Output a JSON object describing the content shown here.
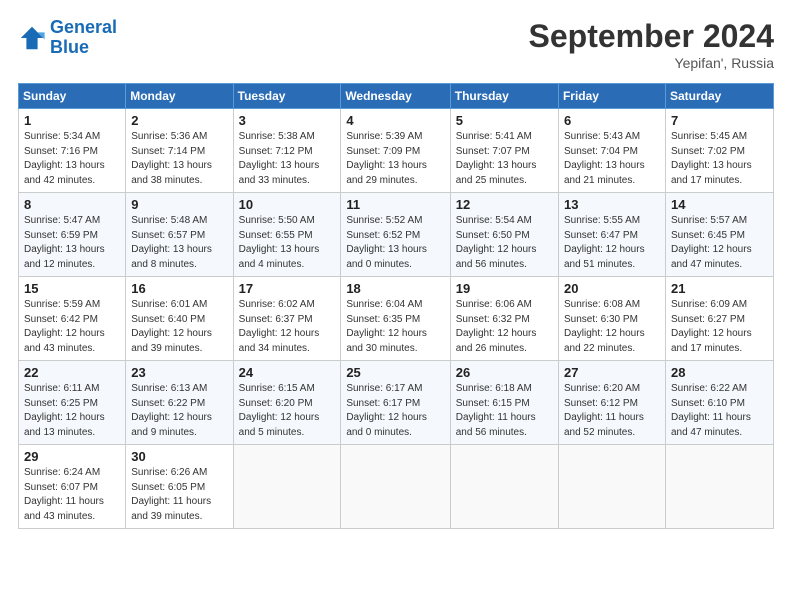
{
  "header": {
    "logo_line1": "General",
    "logo_line2": "Blue",
    "month_title": "September 2024",
    "location": "Yepifan', Russia"
  },
  "weekdays": [
    "Sunday",
    "Monday",
    "Tuesday",
    "Wednesday",
    "Thursday",
    "Friday",
    "Saturday"
  ],
  "weeks": [
    [
      {
        "day": "1",
        "info": "Sunrise: 5:34 AM\nSunset: 7:16 PM\nDaylight: 13 hours\nand 42 minutes."
      },
      {
        "day": "2",
        "info": "Sunrise: 5:36 AM\nSunset: 7:14 PM\nDaylight: 13 hours\nand 38 minutes."
      },
      {
        "day": "3",
        "info": "Sunrise: 5:38 AM\nSunset: 7:12 PM\nDaylight: 13 hours\nand 33 minutes."
      },
      {
        "day": "4",
        "info": "Sunrise: 5:39 AM\nSunset: 7:09 PM\nDaylight: 13 hours\nand 29 minutes."
      },
      {
        "day": "5",
        "info": "Sunrise: 5:41 AM\nSunset: 7:07 PM\nDaylight: 13 hours\nand 25 minutes."
      },
      {
        "day": "6",
        "info": "Sunrise: 5:43 AM\nSunset: 7:04 PM\nDaylight: 13 hours\nand 21 minutes."
      },
      {
        "day": "7",
        "info": "Sunrise: 5:45 AM\nSunset: 7:02 PM\nDaylight: 13 hours\nand 17 minutes."
      }
    ],
    [
      {
        "day": "8",
        "info": "Sunrise: 5:47 AM\nSunset: 6:59 PM\nDaylight: 13 hours\nand 12 minutes."
      },
      {
        "day": "9",
        "info": "Sunrise: 5:48 AM\nSunset: 6:57 PM\nDaylight: 13 hours\nand 8 minutes."
      },
      {
        "day": "10",
        "info": "Sunrise: 5:50 AM\nSunset: 6:55 PM\nDaylight: 13 hours\nand 4 minutes."
      },
      {
        "day": "11",
        "info": "Sunrise: 5:52 AM\nSunset: 6:52 PM\nDaylight: 13 hours\nand 0 minutes."
      },
      {
        "day": "12",
        "info": "Sunrise: 5:54 AM\nSunset: 6:50 PM\nDaylight: 12 hours\nand 56 minutes."
      },
      {
        "day": "13",
        "info": "Sunrise: 5:55 AM\nSunset: 6:47 PM\nDaylight: 12 hours\nand 51 minutes."
      },
      {
        "day": "14",
        "info": "Sunrise: 5:57 AM\nSunset: 6:45 PM\nDaylight: 12 hours\nand 47 minutes."
      }
    ],
    [
      {
        "day": "15",
        "info": "Sunrise: 5:59 AM\nSunset: 6:42 PM\nDaylight: 12 hours\nand 43 minutes."
      },
      {
        "day": "16",
        "info": "Sunrise: 6:01 AM\nSunset: 6:40 PM\nDaylight: 12 hours\nand 39 minutes."
      },
      {
        "day": "17",
        "info": "Sunrise: 6:02 AM\nSunset: 6:37 PM\nDaylight: 12 hours\nand 34 minutes."
      },
      {
        "day": "18",
        "info": "Sunrise: 6:04 AM\nSunset: 6:35 PM\nDaylight: 12 hours\nand 30 minutes."
      },
      {
        "day": "19",
        "info": "Sunrise: 6:06 AM\nSunset: 6:32 PM\nDaylight: 12 hours\nand 26 minutes."
      },
      {
        "day": "20",
        "info": "Sunrise: 6:08 AM\nSunset: 6:30 PM\nDaylight: 12 hours\nand 22 minutes."
      },
      {
        "day": "21",
        "info": "Sunrise: 6:09 AM\nSunset: 6:27 PM\nDaylight: 12 hours\nand 17 minutes."
      }
    ],
    [
      {
        "day": "22",
        "info": "Sunrise: 6:11 AM\nSunset: 6:25 PM\nDaylight: 12 hours\nand 13 minutes."
      },
      {
        "day": "23",
        "info": "Sunrise: 6:13 AM\nSunset: 6:22 PM\nDaylight: 12 hours\nand 9 minutes."
      },
      {
        "day": "24",
        "info": "Sunrise: 6:15 AM\nSunset: 6:20 PM\nDaylight: 12 hours\nand 5 minutes."
      },
      {
        "day": "25",
        "info": "Sunrise: 6:17 AM\nSunset: 6:17 PM\nDaylight: 12 hours\nand 0 minutes."
      },
      {
        "day": "26",
        "info": "Sunrise: 6:18 AM\nSunset: 6:15 PM\nDaylight: 11 hours\nand 56 minutes."
      },
      {
        "day": "27",
        "info": "Sunrise: 6:20 AM\nSunset: 6:12 PM\nDaylight: 11 hours\nand 52 minutes."
      },
      {
        "day": "28",
        "info": "Sunrise: 6:22 AM\nSunset: 6:10 PM\nDaylight: 11 hours\nand 47 minutes."
      }
    ],
    [
      {
        "day": "29",
        "info": "Sunrise: 6:24 AM\nSunset: 6:07 PM\nDaylight: 11 hours\nand 43 minutes."
      },
      {
        "day": "30",
        "info": "Sunrise: 6:26 AM\nSunset: 6:05 PM\nDaylight: 11 hours\nand 39 minutes."
      },
      {
        "day": "",
        "info": ""
      },
      {
        "day": "",
        "info": ""
      },
      {
        "day": "",
        "info": ""
      },
      {
        "day": "",
        "info": ""
      },
      {
        "day": "",
        "info": ""
      }
    ]
  ]
}
